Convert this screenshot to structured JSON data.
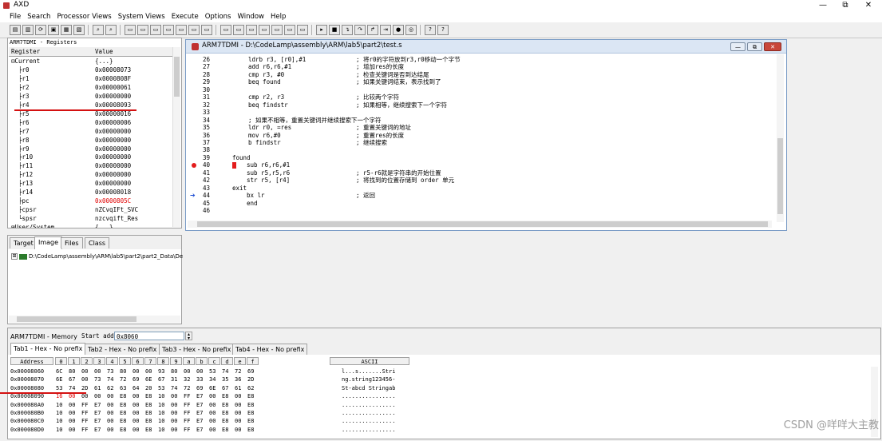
{
  "window": {
    "title": "AXD",
    "minimize_glyph": "—",
    "restore_glyph": "⧉",
    "close_glyph": "✕"
  },
  "menu": [
    "File",
    "Search",
    "Processor Views",
    "System Views",
    "Execute",
    "Options",
    "Window",
    "Help"
  ],
  "registers": {
    "title": "ARM7TDMI - Registers",
    "col_register": "Register",
    "col_value": "Value",
    "rows": [
      {
        "name": "⊟Current",
        "value": "{...}",
        "changed": false
      },
      {
        "name": "  ├r0",
        "value": "0x00008073",
        "changed": false
      },
      {
        "name": "  ├r1",
        "value": "0x0000808F",
        "changed": false
      },
      {
        "name": "  ├r2",
        "value": "0x00000061",
        "changed": false
      },
      {
        "name": "  ├r3",
        "value": "0x00000000",
        "changed": false
      },
      {
        "name": "  ├r4",
        "value": "0x00008093",
        "changed": false
      },
      {
        "name": "  ├r5",
        "value": "0x00000016",
        "changed": false
      },
      {
        "name": "  ├r6",
        "value": "0x00000006",
        "changed": false
      },
      {
        "name": "  ├r7",
        "value": "0x00000000",
        "changed": false
      },
      {
        "name": "  ├r8",
        "value": "0x00000000",
        "changed": false
      },
      {
        "name": "  ├r9",
        "value": "0x00000000",
        "changed": false
      },
      {
        "name": "  ├r10",
        "value": "0x00000000",
        "changed": false
      },
      {
        "name": "  ├r11",
        "value": "0x00000000",
        "changed": false
      },
      {
        "name": "  ├r12",
        "value": "0x00000000",
        "changed": false
      },
      {
        "name": "  ├r13",
        "value": "0x00000000",
        "changed": false
      },
      {
        "name": "  ├r14",
        "value": "0x00008018",
        "changed": false
      },
      {
        "name": "  ├pc",
        "value": "0x0000805C",
        "changed": true
      },
      {
        "name": "  ├cpsr",
        "value": "nZCvqIFt_SVC",
        "changed": false
      },
      {
        "name": "  └spsr",
        "value": "nzcvqift_Res",
        "changed": false
      },
      {
        "name": "⊞User/System",
        "value": "{...}",
        "changed": false
      }
    ]
  },
  "target_panel": {
    "tabs": [
      "Target",
      "Image",
      "Files",
      "Class"
    ],
    "active_tab": "Image",
    "tree_expander": "⊞",
    "tree_path": "D:\\CodeLamp\\assembly\\ARM\\lab5\\part2\\part2_Data\\De"
  },
  "source": {
    "title": "ARM7TDMI - D:\\CodeLamp\\assembly\\ARM\\lab5\\part2\\test.s",
    "breakpoint_line": "40",
    "current_line": "44",
    "lines": [
      {
        "num": "26",
        "code": "ldrb r3, [r0],#1",
        "comment": "; 将r0的字符放到r3,r0移动一个字节"
      },
      {
        "num": "27",
        "code": "add r6,r6,#1",
        "comment": "; 增加res的长度"
      },
      {
        "num": "28",
        "code": "cmp r3, #0",
        "comment": "; 检查关键词是否到达结尾"
      },
      {
        "num": "29",
        "code": "beq found",
        "comment": "; 如果关键词结束，表示找到了"
      },
      {
        "num": "30",
        "code": "",
        "comment": ""
      },
      {
        "num": "31",
        "code": "cmp r2, r3",
        "comment": "; 比较两个字符"
      },
      {
        "num": "32",
        "code": "beq findstr",
        "comment": "; 如果相等，继续搜索下一个字符"
      },
      {
        "num": "33",
        "code": "",
        "comment": ""
      },
      {
        "num": "34",
        "code": "; 如果不相等，重置关键词并继续搜索下一个字符",
        "comment": ""
      },
      {
        "num": "35",
        "code": "ldr r0, =res",
        "comment": "; 重置关键词的地址"
      },
      {
        "num": "36",
        "code": "mov r6,#0",
        "comment": "; 重置res的长度"
      },
      {
        "num": "37",
        "code": "b findstr",
        "comment": "; 继续搜索"
      },
      {
        "num": "38",
        "code": "",
        "comment": ""
      },
      {
        "num": "39",
        "code": "found",
        "comment": ""
      },
      {
        "num": "40",
        "code": "sub r6,r6,#1",
        "comment": ""
      },
      {
        "num": "41",
        "code": "sub r5,r5,r6",
        "comment": "; r5-r6就是字符串的开始位置"
      },
      {
        "num": "42",
        "code": "str r5, [r4]",
        "comment": "; 将找到的位置存储到 order 单元"
      },
      {
        "num": "43",
        "code": "exit",
        "comment": ""
      },
      {
        "num": "44",
        "code": "bx lr",
        "comment": "; 返回"
      },
      {
        "num": "45",
        "code": "end",
        "comment": ""
      },
      {
        "num": "46",
        "code": "",
        "comment": ""
      }
    ]
  },
  "memory": {
    "title": "ARM7TDMI - Memory",
    "start_label": "Start address",
    "start_value": "0x8060",
    "tabs": [
      "Tab1 - Hex - No prefix",
      "Tab2 - Hex - No prefix",
      "Tab3 - Hex - No prefix",
      "Tab4 - Hex - No prefix"
    ],
    "active_tab": 0,
    "columns": [
      "Address",
      "0",
      "1",
      "2",
      "3",
      "4",
      "5",
      "6",
      "7",
      "8",
      "9",
      "a",
      "b",
      "c",
      "d",
      "e",
      "f",
      "ASCII"
    ],
    "rows": [
      {
        "addr": "0x00008060",
        "bytes": [
          "6C",
          "80",
          "00",
          "00",
          "73",
          "80",
          "00",
          "00",
          "93",
          "80",
          "00",
          "00",
          "53",
          "74",
          "72",
          "69"
        ],
        "ascii": "l...s.......Stri",
        "changed": []
      },
      {
        "addr": "0x00008070",
        "bytes": [
          "6E",
          "67",
          "00",
          "73",
          "74",
          "72",
          "69",
          "6E",
          "67",
          "31",
          "32",
          "33",
          "34",
          "35",
          "36",
          "2D"
        ],
        "ascii": "ng.string123456-",
        "changed": []
      },
      {
        "addr": "0x00008080",
        "bytes": [
          "53",
          "74",
          "2D",
          "61",
          "62",
          "63",
          "64",
          "20",
          "53",
          "74",
          "72",
          "69",
          "6E",
          "67",
          "61",
          "62"
        ],
        "ascii": "St-abcd Stringab",
        "changed": []
      },
      {
        "addr": "0x00008090",
        "bytes": [
          "16",
          "00",
          "00",
          "00",
          "00",
          "E8",
          "00",
          "E8",
          "10",
          "00",
          "FF",
          "E7",
          "00",
          "E8",
          "00",
          "E8"
        ],
        "ascii": "................",
        "changed": [
          0,
          1
        ]
      },
      {
        "addr": "0x000080A0",
        "bytes": [
          "10",
          "00",
          "FF",
          "E7",
          "00",
          "E8",
          "00",
          "E8",
          "10",
          "00",
          "FF",
          "E7",
          "00",
          "E8",
          "00",
          "E8"
        ],
        "ascii": "................",
        "changed": []
      },
      {
        "addr": "0x000080B0",
        "bytes": [
          "10",
          "00",
          "FF",
          "E7",
          "00",
          "E8",
          "00",
          "E8",
          "10",
          "00",
          "FF",
          "E7",
          "00",
          "E8",
          "00",
          "E8"
        ],
        "ascii": "................",
        "changed": []
      },
      {
        "addr": "0x000080C0",
        "bytes": [
          "10",
          "00",
          "FF",
          "E7",
          "00",
          "E8",
          "00",
          "E8",
          "10",
          "00",
          "FF",
          "E7",
          "00",
          "E8",
          "00",
          "E8"
        ],
        "ascii": "................",
        "changed": []
      },
      {
        "addr": "0x000080D0",
        "bytes": [
          "10",
          "00",
          "FF",
          "E7",
          "00",
          "E8",
          "00",
          "E8",
          "10",
          "00",
          "FF",
          "E7",
          "00",
          "E8",
          "00",
          "E8"
        ],
        "ascii": "................",
        "changed": []
      }
    ]
  },
  "watermark": "CSDN @咩咩大主教",
  "colors": {
    "changed": "#e00000",
    "breakpoint": "#e31c1c",
    "pc_arrow": "#1f4fd4",
    "annotation": "#d41111"
  },
  "toolbar_icons": [
    "new-file-icon",
    "open-file-icon",
    "reload-icon",
    "load-image-icon",
    "save-icon",
    "close-file-icon",
    "find-icon",
    "find-next-icon",
    "registers-view-icon",
    "watch-view-icon",
    "variables-view-icon",
    "backtrace-view-icon",
    "memory-view-icon",
    "disassembly-view-icon",
    "source-view-icon",
    "system-registers-icon",
    "system-memory-icon",
    "system-console-icon",
    "system-output-icon",
    "system-debug-icon",
    "system-image-icon",
    "system-low-icon",
    "go-icon",
    "stop-icon",
    "step-in-icon",
    "step-over-icon",
    "step-out-icon",
    "run-to-cursor-icon",
    "toggle-breakpoint-icon",
    "set-watchpoint-icon",
    "help-icon",
    "context-help-icon"
  ]
}
